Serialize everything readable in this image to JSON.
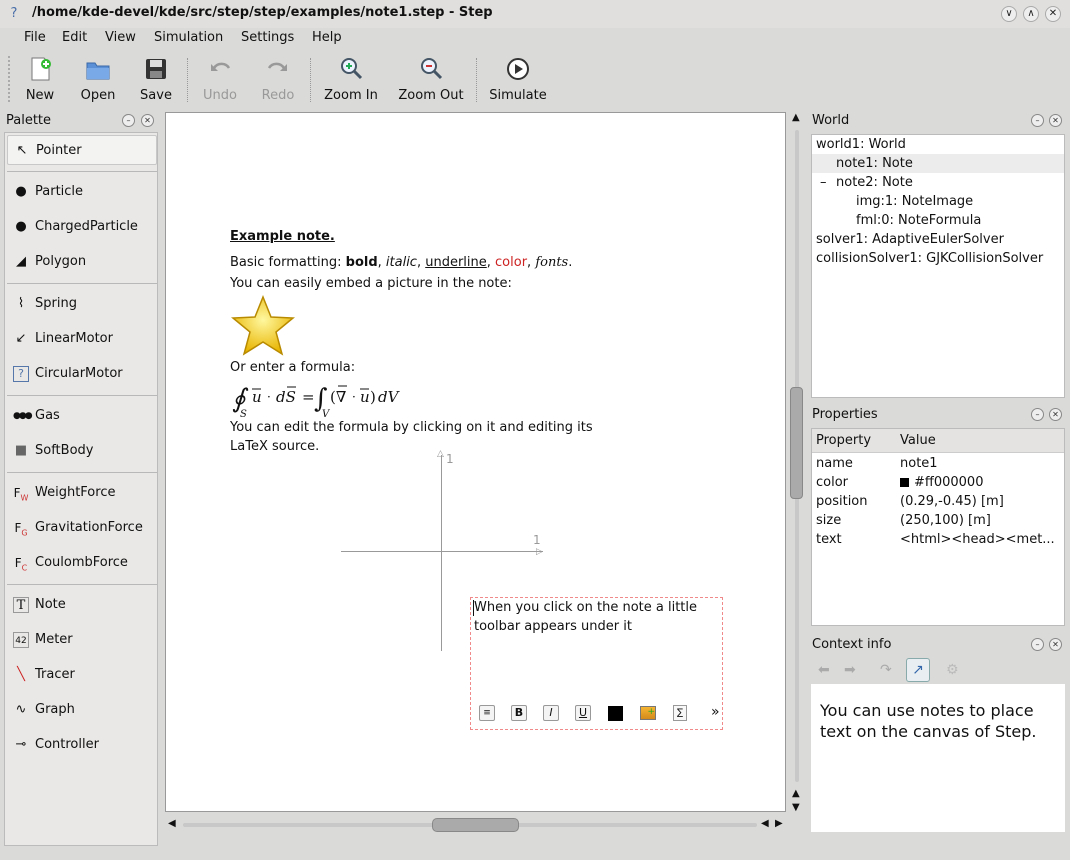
{
  "window": {
    "title": "/home/kde-devel/kde/src/step/step/examples/note1.step - Step",
    "buttons": [
      "minimize",
      "maximize",
      "close"
    ]
  },
  "menubar": {
    "items": [
      {
        "label": "File"
      },
      {
        "label": "Edit"
      },
      {
        "label": "View"
      },
      {
        "label": "Simulation"
      },
      {
        "label": "Settings"
      },
      {
        "label": "Help"
      }
    ]
  },
  "toolbar": {
    "new": "New",
    "open": "Open",
    "save": "Save",
    "undo": "Undo",
    "redo": "Redo",
    "zoom_in": "Zoom In",
    "zoom_out": "Zoom Out",
    "simulate": "Simulate"
  },
  "palette": {
    "title": "Palette",
    "items": [
      {
        "label": "Pointer",
        "icon": "pointer-icon"
      },
      {
        "label": "Particle",
        "icon": "particle-icon"
      },
      {
        "label": "ChargedParticle",
        "icon": "charged-particle-icon"
      },
      {
        "label": "Polygon",
        "icon": "polygon-icon"
      },
      {
        "label": "Spring",
        "icon": "spring-icon"
      },
      {
        "label": "LinearMotor",
        "icon": "linear-motor-icon"
      },
      {
        "label": "CircularMotor",
        "icon": "circular-motor-icon"
      },
      {
        "label": "Gas",
        "icon": "gas-icon"
      },
      {
        "label": "SoftBody",
        "icon": "softbody-icon"
      },
      {
        "label": "WeightForce",
        "icon": "weight-force-icon"
      },
      {
        "label": "GravitationForce",
        "icon": "gravitation-force-icon"
      },
      {
        "label": "CoulombForce",
        "icon": "coulomb-force-icon"
      },
      {
        "label": "Note",
        "icon": "note-icon"
      },
      {
        "label": "Meter",
        "icon": "meter-icon"
      },
      {
        "label": "Tracer",
        "icon": "tracer-icon"
      },
      {
        "label": "Graph",
        "icon": "graph-icon"
      },
      {
        "label": "Controller",
        "icon": "controller-icon"
      }
    ]
  },
  "note": {
    "heading": "Example note.",
    "basic_prefix": "Basic formatting: ",
    "bold": "bold",
    "comma": ", ",
    "italic": "italic",
    "underline": "underline",
    "color": "color",
    "fonts": "fonts",
    "period": ".",
    "embed_text": "You can easily embed a picture in the note:",
    "formula_intro": "Or enter a formula:",
    "edit_text_1": "You can edit the formula by clicking on it and editing its",
    "edit_text_2": "LaTeX source.",
    "text_color": "#cc2222"
  },
  "axes": {
    "x_label": "1",
    "y_label": "1"
  },
  "note2": {
    "text_1": "When you click on the note a little",
    "text_2": "toolbar appears under it",
    "more": "»"
  },
  "world": {
    "title": "World",
    "rows": [
      {
        "label": "world1: World",
        "indent": 0,
        "toggle": ""
      },
      {
        "label": "note1: Note",
        "indent": 1,
        "toggle": ""
      },
      {
        "label": "note2: Note",
        "indent": 1,
        "toggle": "–"
      },
      {
        "label": "img:1: NoteImage",
        "indent": 2,
        "toggle": ""
      },
      {
        "label": "fml:0: NoteFormula",
        "indent": 2,
        "toggle": ""
      },
      {
        "label": "solver1: AdaptiveEulerSolver",
        "indent": 0,
        "toggle": ""
      },
      {
        "label": "collisionSolver1: GJKCollisionSolver",
        "indent": 0,
        "toggle": ""
      }
    ]
  },
  "properties": {
    "title": "Properties",
    "col_property": "Property",
    "col_value": "Value",
    "rows": [
      {
        "name": "name",
        "value": "note1"
      },
      {
        "name": "color",
        "value": "#ff000000"
      },
      {
        "name": "position",
        "value": "(0.29,-0.45) [m]"
      },
      {
        "name": "size",
        "value": "(250,100) [m]"
      },
      {
        "name": "text",
        "value": "<html><head><met..."
      }
    ]
  },
  "context": {
    "title": "Context info",
    "text": "You can use notes to place text on the canvas of Step."
  }
}
